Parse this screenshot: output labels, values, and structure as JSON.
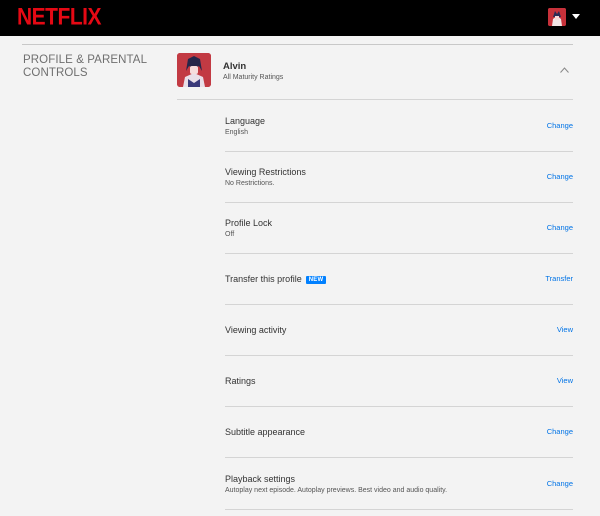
{
  "header": {
    "logo": "NETFLIX",
    "avatar_icon": "profile-avatar-icon",
    "menu_icon": "caret-down-icon"
  },
  "section": {
    "title": "PROFILE & PARENTAL CONTROLS"
  },
  "profile": {
    "name": "Alvin",
    "maturity": "All Maturity Ratings",
    "collapse_icon": "chevron-up-icon"
  },
  "settings": [
    {
      "label": "Language",
      "value": "English",
      "action": "Change"
    },
    {
      "label": "Viewing Restrictions",
      "value": "No Restrictions.",
      "action": "Change"
    },
    {
      "label": "Profile Lock",
      "value": "Off",
      "action": "Change"
    },
    {
      "label": "Transfer this profile",
      "badge": "NEW",
      "value": "",
      "action": "Transfer"
    },
    {
      "label": "Viewing activity",
      "value": "",
      "action": "View"
    },
    {
      "label": "Ratings",
      "value": "",
      "action": "View"
    },
    {
      "label": "Subtitle appearance",
      "value": "",
      "action": "Change"
    },
    {
      "label": "Playback settings",
      "value": "Autoplay next episode. Autoplay previews. Best video and audio quality.",
      "action": "Change"
    }
  ],
  "colors": {
    "brand": "#e50914",
    "link": "#0073e6",
    "badge": "#0080ff",
    "background": "#f3f3f3",
    "header": "#000000"
  }
}
